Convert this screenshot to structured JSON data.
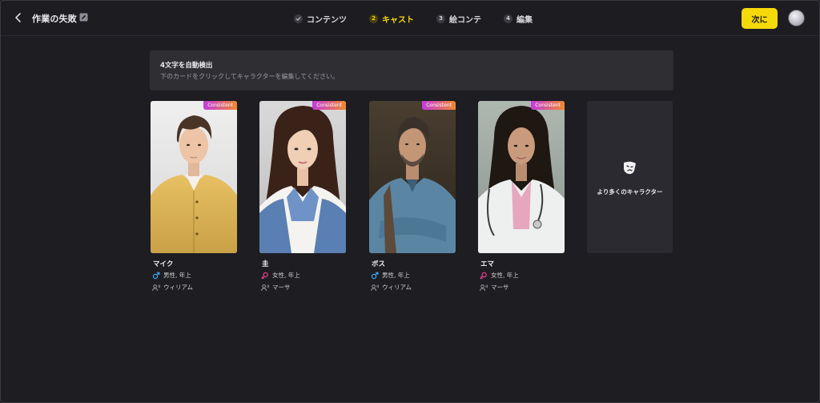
{
  "header": {
    "project_title": "作業の失敗",
    "steps": [
      {
        "number": "",
        "label": "コンテンツ",
        "state": "done"
      },
      {
        "number": "2",
        "label": "キャスト",
        "state": "active"
      },
      {
        "number": "3",
        "label": "絵コンテ",
        "state": "pending"
      },
      {
        "number": "4",
        "label": "編集",
        "state": "pending"
      }
    ],
    "next_label": "次に"
  },
  "banner": {
    "title": "4文字を自動検出",
    "description": "下のカードをクリックしてキャラクターを編集してください。"
  },
  "badge_label": "Consistent",
  "characters": [
    {
      "name": "マイク",
      "gender": "male",
      "attributes": "男性, 年上",
      "voice": "ウィリアム"
    },
    {
      "name": "圭",
      "gender": "female",
      "attributes": "女性, 年上",
      "voice": "マーサ"
    },
    {
      "name": "ボス",
      "gender": "male",
      "attributes": "男性, 年上",
      "voice": "ウィリアム"
    },
    {
      "name": "エマ",
      "gender": "female",
      "attributes": "女性, 年上",
      "voice": "マーサ"
    }
  ],
  "more_characters_label": "より多くのキャラクター",
  "colors": {
    "accent": "#f5d90a",
    "male_icon": "#3fa7f5",
    "female_icon": "#e8418f",
    "badge_gradient_start": "#c33be0",
    "badge_gradient_end": "#f08a2e"
  },
  "icons": {
    "back": "chevron-left-icon",
    "edit": "edit-icon",
    "step_done": "check-icon",
    "male": "male-icon",
    "female": "female-icon",
    "voice": "voice-icon",
    "more": "theater-masks-icon"
  }
}
